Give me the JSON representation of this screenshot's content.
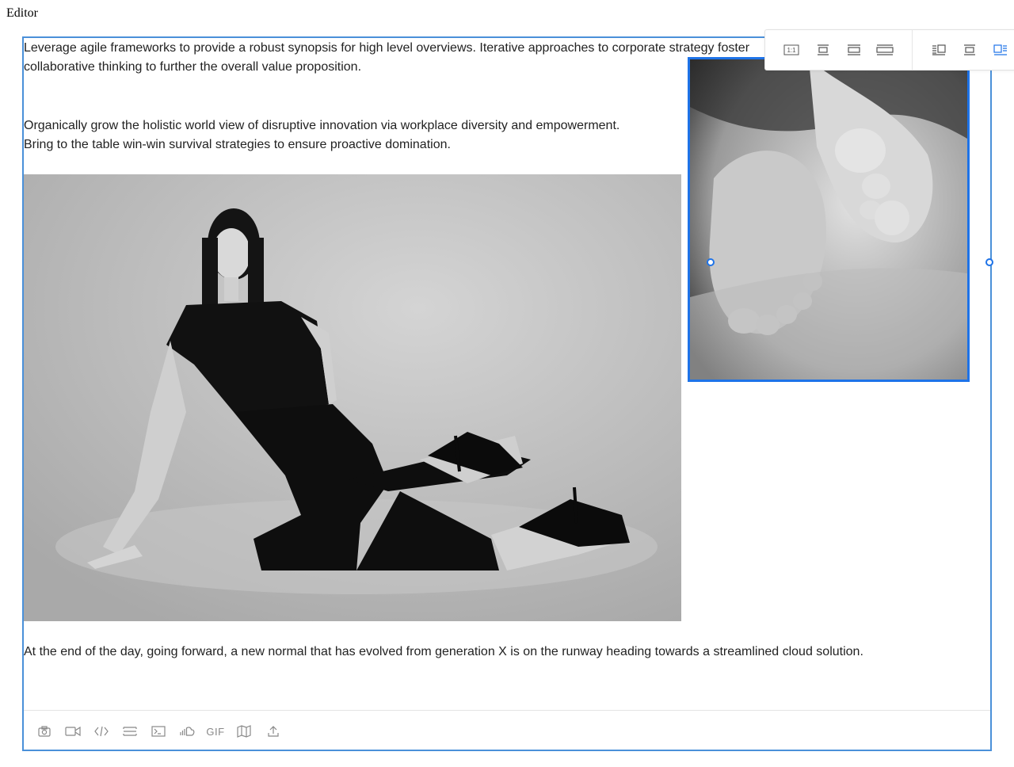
{
  "page": {
    "title": "Editor"
  },
  "content": {
    "paragraphs": [
      "Leverage agile frameworks to provide a robust synopsis for high level overviews. Iterative approaches to corporate strategy foster collaborative thinking to further the overall value proposition.",
      "Organically grow the holistic world view of disruptive innovation via workplace diversity and empowerment.",
      "Bring to the table win-win survival strategies to ensure proactive domination.",
      "At the end of the day, going forward, a new normal that has evolved from generation X is on the runway heading towards a streamlined cloud solution."
    ]
  },
  "image_toolbar": {
    "buttons": [
      {
        "name": "original-size",
        "icon": "one-to-one-icon",
        "label": "1:1"
      },
      {
        "name": "small-width",
        "icon": "size-small-icon"
      },
      {
        "name": "medium-width",
        "icon": "size-medium-icon"
      },
      {
        "name": "full-width",
        "icon": "size-full-icon"
      },
      {
        "name": "float-right",
        "icon": "float-right-icon"
      },
      {
        "name": "center",
        "icon": "center-icon"
      },
      {
        "name": "float-left",
        "icon": "float-left-icon",
        "active": true
      }
    ]
  },
  "insert_toolbar": {
    "buttons": [
      {
        "name": "insert-image",
        "icon": "camera-icon"
      },
      {
        "name": "insert-video",
        "icon": "video-icon"
      },
      {
        "name": "insert-embed",
        "icon": "code-icon"
      },
      {
        "name": "insert-divider",
        "icon": "divider-icon"
      },
      {
        "name": "insert-code-block",
        "icon": "terminal-icon"
      },
      {
        "name": "insert-soundcloud",
        "icon": "soundcloud-icon"
      },
      {
        "name": "insert-gif",
        "icon": "gif-icon",
        "label": "GIF"
      },
      {
        "name": "insert-map",
        "icon": "map-icon"
      },
      {
        "name": "upload-file",
        "icon": "upload-icon"
      }
    ]
  },
  "colors": {
    "selection_blue": "#1e73e8",
    "editor_border": "#4a90d9",
    "icon_gray": "#888888",
    "text": "#222222"
  }
}
